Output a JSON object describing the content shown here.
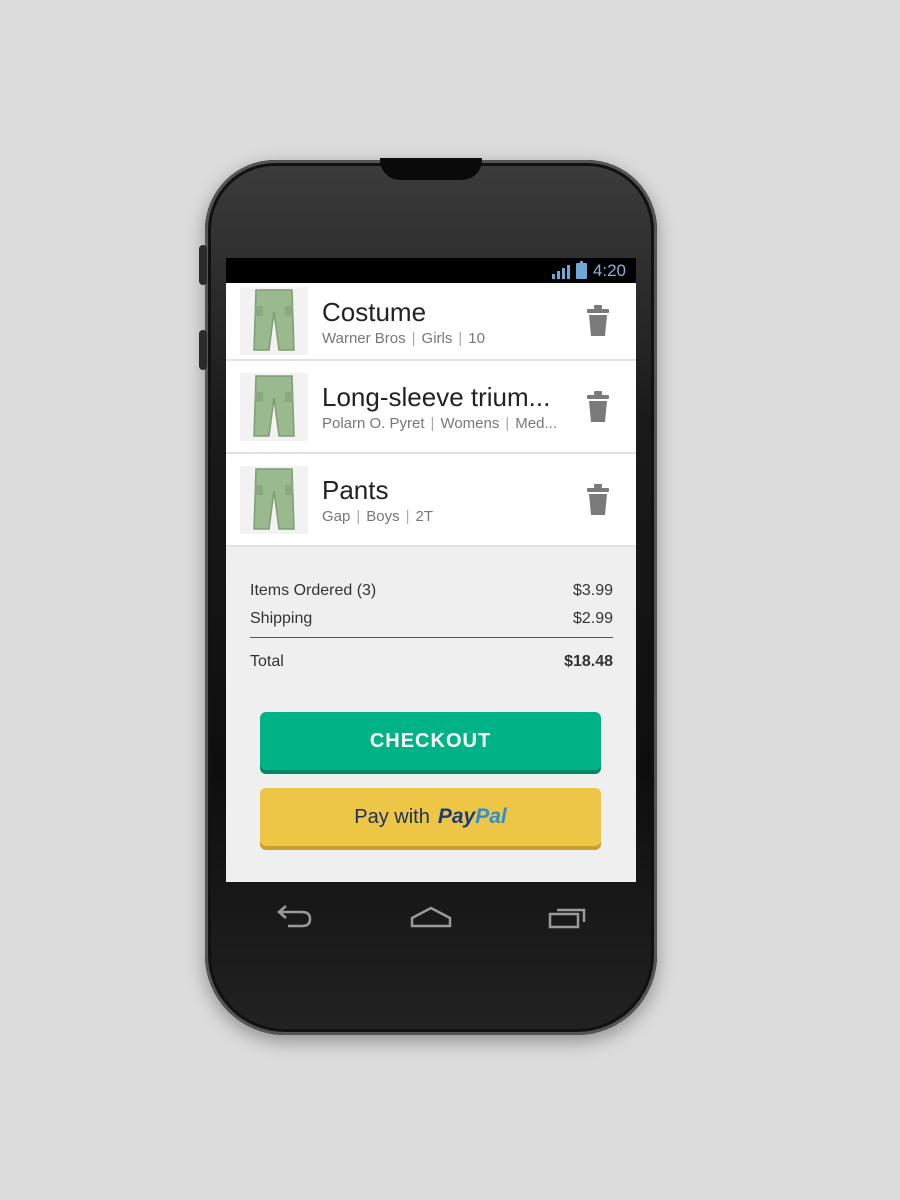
{
  "status_bar": {
    "time": "4:20"
  },
  "cart_items": [
    {
      "title": "Costume",
      "brand": "Warner Bros",
      "category": "Girls",
      "size": "10"
    },
    {
      "title": "Long-sleeve trium...",
      "brand": "Polarn O. Pyret",
      "category": "Womens",
      "size": "Med..."
    },
    {
      "title": "Pants",
      "brand": "Gap",
      "category": "Boys",
      "size": "2T"
    }
  ],
  "summary": {
    "items_label": "Items Ordered (3)",
    "items_value": "$3.99",
    "shipping_label": "Shipping",
    "shipping_value": "$2.99",
    "total_label": "Total",
    "total_value": "$18.48"
  },
  "buttons": {
    "checkout": "CHECKOUT",
    "paypal_prefix": "Pay with",
    "paypal_brand_1": "Pay",
    "paypal_brand_2": "Pal"
  },
  "colors": {
    "checkout": "#00b386",
    "paypal": "#edc645",
    "status_accent": "#7fb6e0"
  }
}
